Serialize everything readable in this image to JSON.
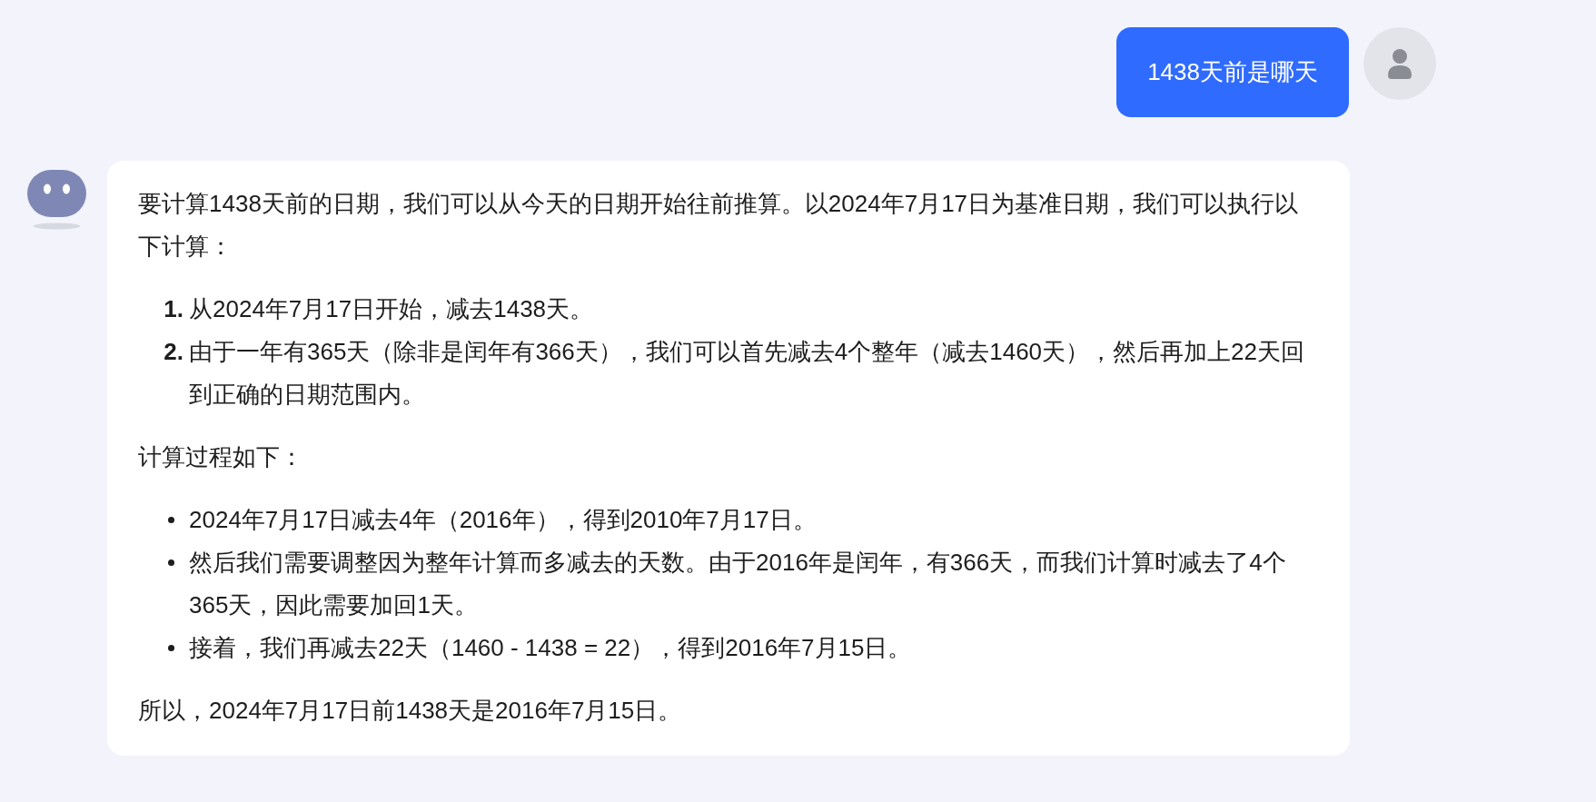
{
  "user_message": {
    "text": "1438天前是哪天"
  },
  "reply": {
    "blocks": [
      {
        "kind": "paragraph",
        "text": "要计算1438天前的日期，我们可以从今天的日期开始往前推算。以2024年7月17日为基准日期，我们可以执行以下计算："
      },
      {
        "kind": "ordered",
        "items": [
          {
            "marker": "1.",
            "text": "从2024年7月17日开始，减去1438天。"
          },
          {
            "marker": "2.",
            "text": "由于一年有365天（除非是闰年有366天），我们可以首先减去4个整年（减去1460天），然后再加上22天回到正确的日期范围内。"
          }
        ]
      },
      {
        "kind": "paragraph",
        "text": "计算过程如下："
      },
      {
        "kind": "bullets",
        "items": [
          {
            "text": "2024年7月17日减去4年（2016年），得到2010年7月17日。"
          },
          {
            "text": "然后我们需要调整因为整年计算而多减去的天数。由于2016年是闰年，有366天，而我们计算时减去了4个365天，因此需要加回1天。"
          },
          {
            "text": "接着，我们再减去22天（1460 - 1438 = 22），得到2016年7月15日。"
          }
        ]
      },
      {
        "kind": "paragraph",
        "text": "所以，2024年7月17日前1438天是2016年7月15日。"
      }
    ]
  }
}
